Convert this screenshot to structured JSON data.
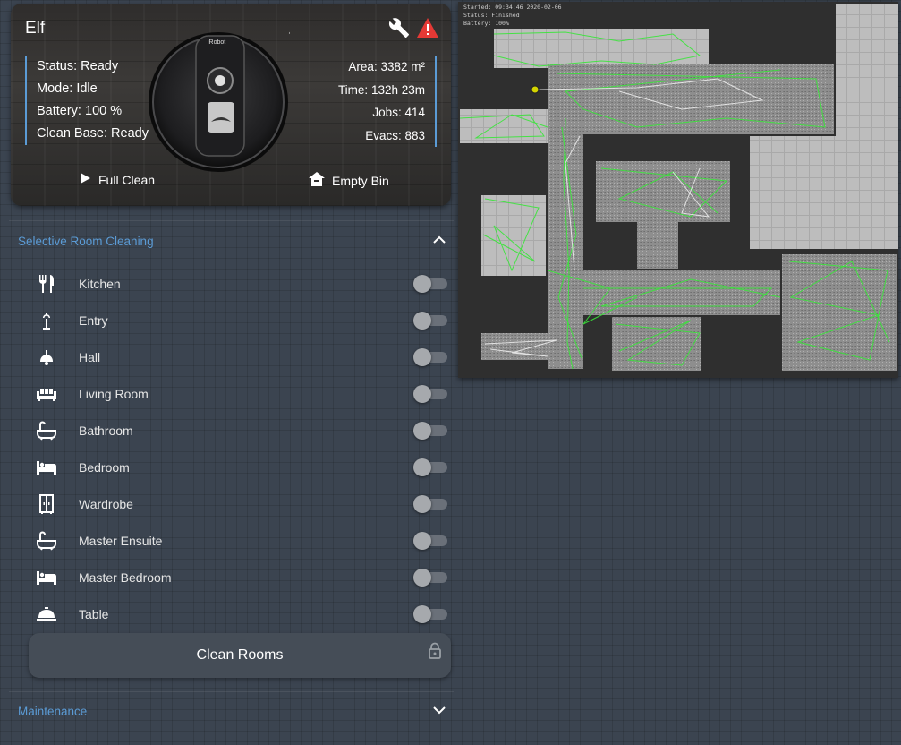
{
  "vacuum": {
    "name": "Elf",
    "stats_left": [
      {
        "label": "Status:",
        "value": "Ready"
      },
      {
        "label": "Mode:",
        "value": "Idle"
      },
      {
        "label": "Battery:",
        "value": "100 %"
      },
      {
        "label": "Clean Base:",
        "value": "Ready"
      }
    ],
    "stats_right": [
      {
        "label": "Area:",
        "value": "3382 m²"
      },
      {
        "label": "Time:",
        "value": "132h 23m"
      },
      {
        "label": "Jobs:",
        "value": "414"
      },
      {
        "label": "Evacs:",
        "value": "883"
      }
    ],
    "actions": {
      "full_clean": "Full Clean",
      "empty_bin": "Empty Bin"
    },
    "robot_brand": "iRobot",
    "icons": {
      "maintenance": "wrench-icon",
      "alert": "warning-icon"
    },
    "colors": {
      "accent": "#5b9bd5",
      "alert": "#e53935"
    }
  },
  "room_cleaning": {
    "title": "Selective Room Cleaning",
    "rooms": [
      {
        "label": "Kitchen",
        "icon": "silverware-icon",
        "on": false
      },
      {
        "label": "Entry",
        "icon": "coat-rack-icon",
        "on": false
      },
      {
        "label": "Hall",
        "icon": "ceiling-light-icon",
        "on": false
      },
      {
        "label": "Living Room",
        "icon": "sofa-icon",
        "on": false
      },
      {
        "label": "Bathroom",
        "icon": "bathtub-icon",
        "on": false
      },
      {
        "label": "Bedroom",
        "icon": "bed-icon",
        "on": false
      },
      {
        "label": "Wardrobe",
        "icon": "wardrobe-icon",
        "on": false
      },
      {
        "label": "Master Ensuite",
        "icon": "bathtub-icon",
        "on": false
      },
      {
        "label": "Master Bedroom",
        "icon": "bed-icon",
        "on": false
      },
      {
        "label": "Table",
        "icon": "room-service-icon",
        "on": false
      }
    ],
    "button_label": "Clean Rooms"
  },
  "maintenance": {
    "title": "Maintenance"
  },
  "map": {
    "status_lines": [
      "Started: 09:34:46 2020-02-06",
      "Status: Finished",
      "Battery: 100%"
    ]
  }
}
